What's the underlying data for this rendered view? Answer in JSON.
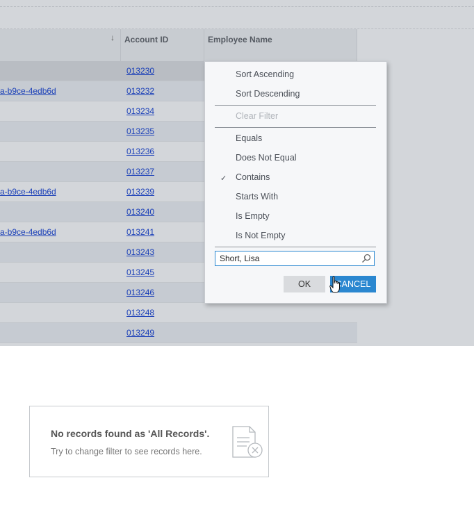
{
  "grid": {
    "columns": [
      {
        "label": "",
        "sort_icon": "arrow-down-icon"
      },
      {
        "label": "Account ID"
      },
      {
        "label": "Employee Name"
      }
    ],
    "rows": [
      {
        "c1": "",
        "account_id": "013230"
      },
      {
        "c1": "a-b9ce-4edb6d",
        "account_id": "013232"
      },
      {
        "c1": "",
        "account_id": "013234"
      },
      {
        "c1": "",
        "account_id": "013235"
      },
      {
        "c1": "",
        "account_id": "013236"
      },
      {
        "c1": "",
        "account_id": "013237"
      },
      {
        "c1": "a-b9ce-4edb6d",
        "account_id": "013239"
      },
      {
        "c1": "",
        "account_id": "013240"
      },
      {
        "c1": "a-b9ce-4edb6d",
        "account_id": "013241"
      },
      {
        "c1": "",
        "account_id": "013243"
      },
      {
        "c1": "",
        "account_id": "013245"
      },
      {
        "c1": "",
        "account_id": "013246"
      },
      {
        "c1": "",
        "account_id": "013248"
      },
      {
        "c1": "",
        "account_id": "013249"
      }
    ]
  },
  "filter_menu": {
    "sort_ascending": "Sort Ascending",
    "sort_descending": "Sort Descending",
    "clear_filter": "Clear Filter",
    "equals": "Equals",
    "does_not_equal": "Does Not Equal",
    "contains": "Contains",
    "starts_with": "Starts With",
    "is_empty": "Is Empty",
    "is_not_empty": "Is Not Empty",
    "check_mark": "✓",
    "selected_condition": "Contains",
    "filter_value": "Short, Lisa",
    "ok_label": "OK",
    "cancel_label": "CANCEL"
  },
  "empty_state": {
    "title": "No records found as 'All Records'.",
    "subtitle": "Try to change filter to see records here.",
    "icon": "document-x-icon"
  },
  "colors": {
    "accent": "#2a87d0",
    "link": "#1a3fb8"
  }
}
